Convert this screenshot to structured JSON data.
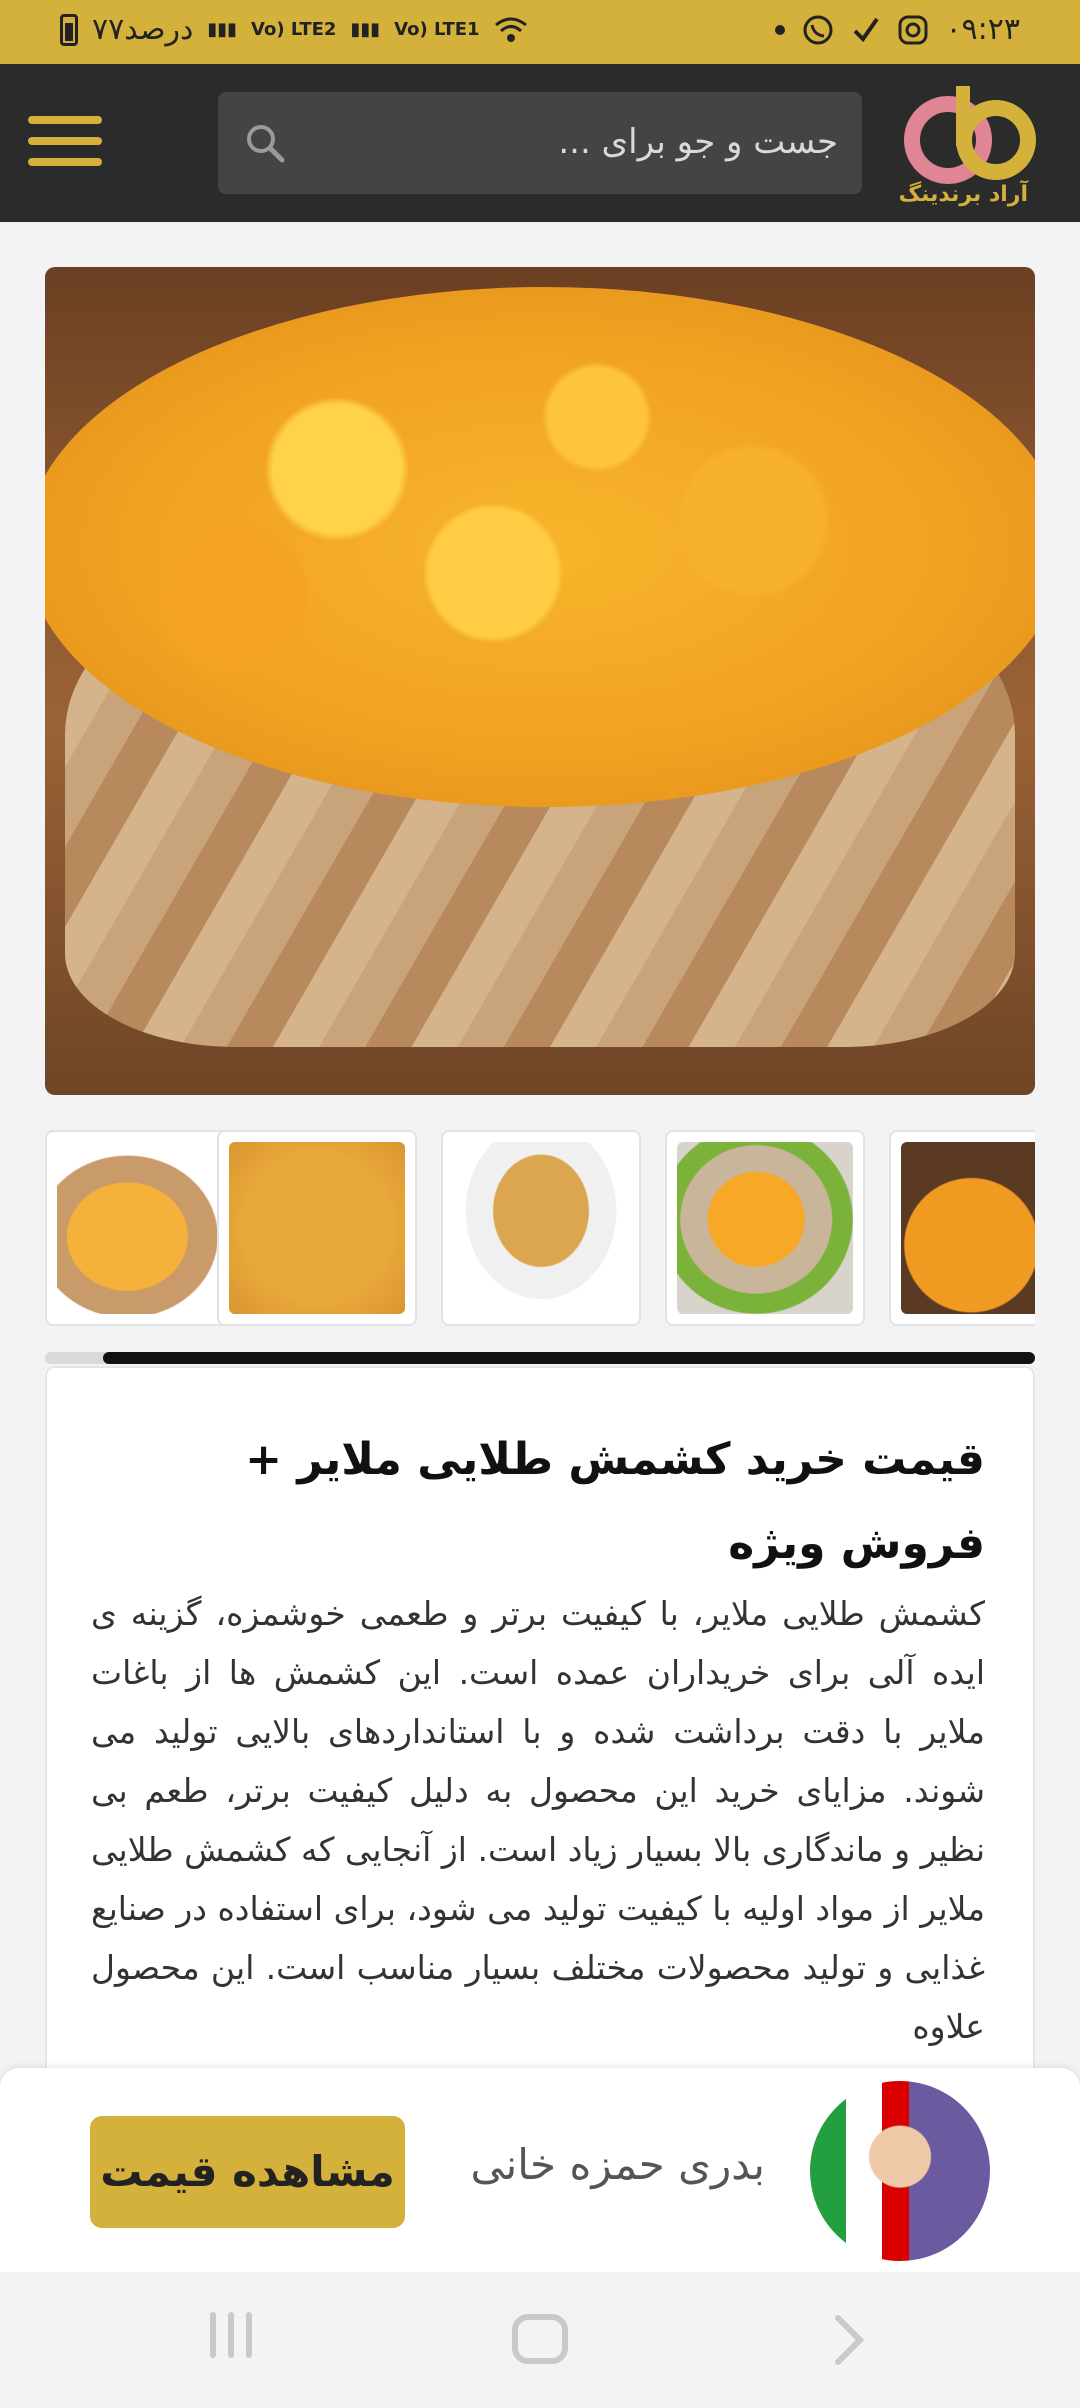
{
  "status_bar": {
    "time": "۰۹:۲۳",
    "battery_text": "۷۷درصد",
    "network_1": "Vo) LTE2",
    "network_2": "Vo) LTE1"
  },
  "header": {
    "logo_text": "آراد برندینگ",
    "search_placeholder": "جست و جو برای ...",
    "accent_color": "#d4b13a",
    "background_color": "#2b2b2b"
  },
  "product": {
    "title": "قیمت خرید کشمش طلایی ملایر + فروش ویژه",
    "description": "کشمش طلایی ملایر، با کیفیت برتر و طعمی خوشمزه، گزینه ی ایده آلی برای خریداران عمده است. این کشمش ها از باغات ملایر با دقت برداشت شده و با استانداردهای بالایی تولید می شوند. مزایای خرید این محصول به دلیل کیفیت برتر، طعم بی نظیر و ماندگاری بالا بسیار زیاد است. از آنجایی که کشمش طلایی ملایر از مواد اولیه با کیفیت تولید می شود، برای استفاده در صنایع غذایی و تولید محصولات مختلف بسیار مناسب است. این محصول علاوه"
  },
  "seller": {
    "name": "بدری حمزه خانی",
    "cta_label": "مشاهده قیمت"
  },
  "icons": {
    "search": "search-icon",
    "menu": "hamburger-menu-icon",
    "whatsapp": "whatsapp-icon",
    "instagram": "instagram-icon",
    "wifi": "wifi-icon"
  }
}
